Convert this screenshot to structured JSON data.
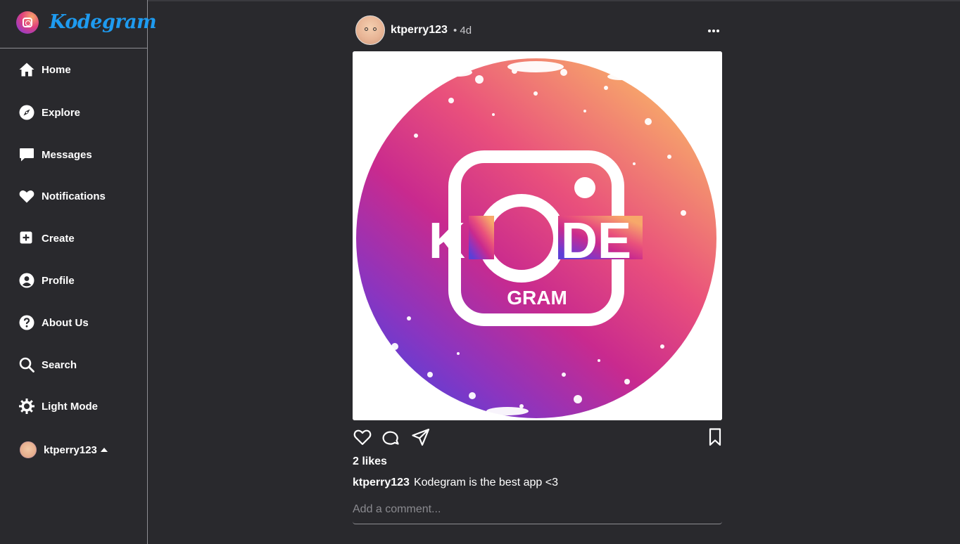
{
  "brand": {
    "name": "Kodegram"
  },
  "nav": {
    "items": [
      {
        "label": "Home",
        "icon": "home-icon"
      },
      {
        "label": "Explore",
        "icon": "compass-icon"
      },
      {
        "label": "Messages",
        "icon": "message-icon"
      },
      {
        "label": "Notifications",
        "icon": "heart-icon"
      },
      {
        "label": "Create",
        "icon": "plus-square-icon"
      },
      {
        "label": "Profile",
        "icon": "user-circle-icon"
      },
      {
        "label": "About Us",
        "icon": "question-circle-icon"
      },
      {
        "label": "Search",
        "icon": "search-icon"
      },
      {
        "label": "Light Mode",
        "icon": "sun-icon"
      }
    ],
    "account": {
      "username": "ktperry123"
    }
  },
  "post": {
    "username": "ktperry123",
    "time": "• 4d",
    "image": {
      "logo_text": "KODE",
      "logo_subtext": "GRAM"
    },
    "likes": "2 likes",
    "caption_user": "ktperry123",
    "caption_text": "Kodegram is the best app <3",
    "comment_placeholder": "Add a comment..."
  },
  "colors": {
    "background": "#29292d",
    "brand": "#1e9bf0",
    "gradient": [
      "#f7a86a",
      "#e94a7e",
      "#c42a8c",
      "#6e3fd4"
    ]
  }
}
